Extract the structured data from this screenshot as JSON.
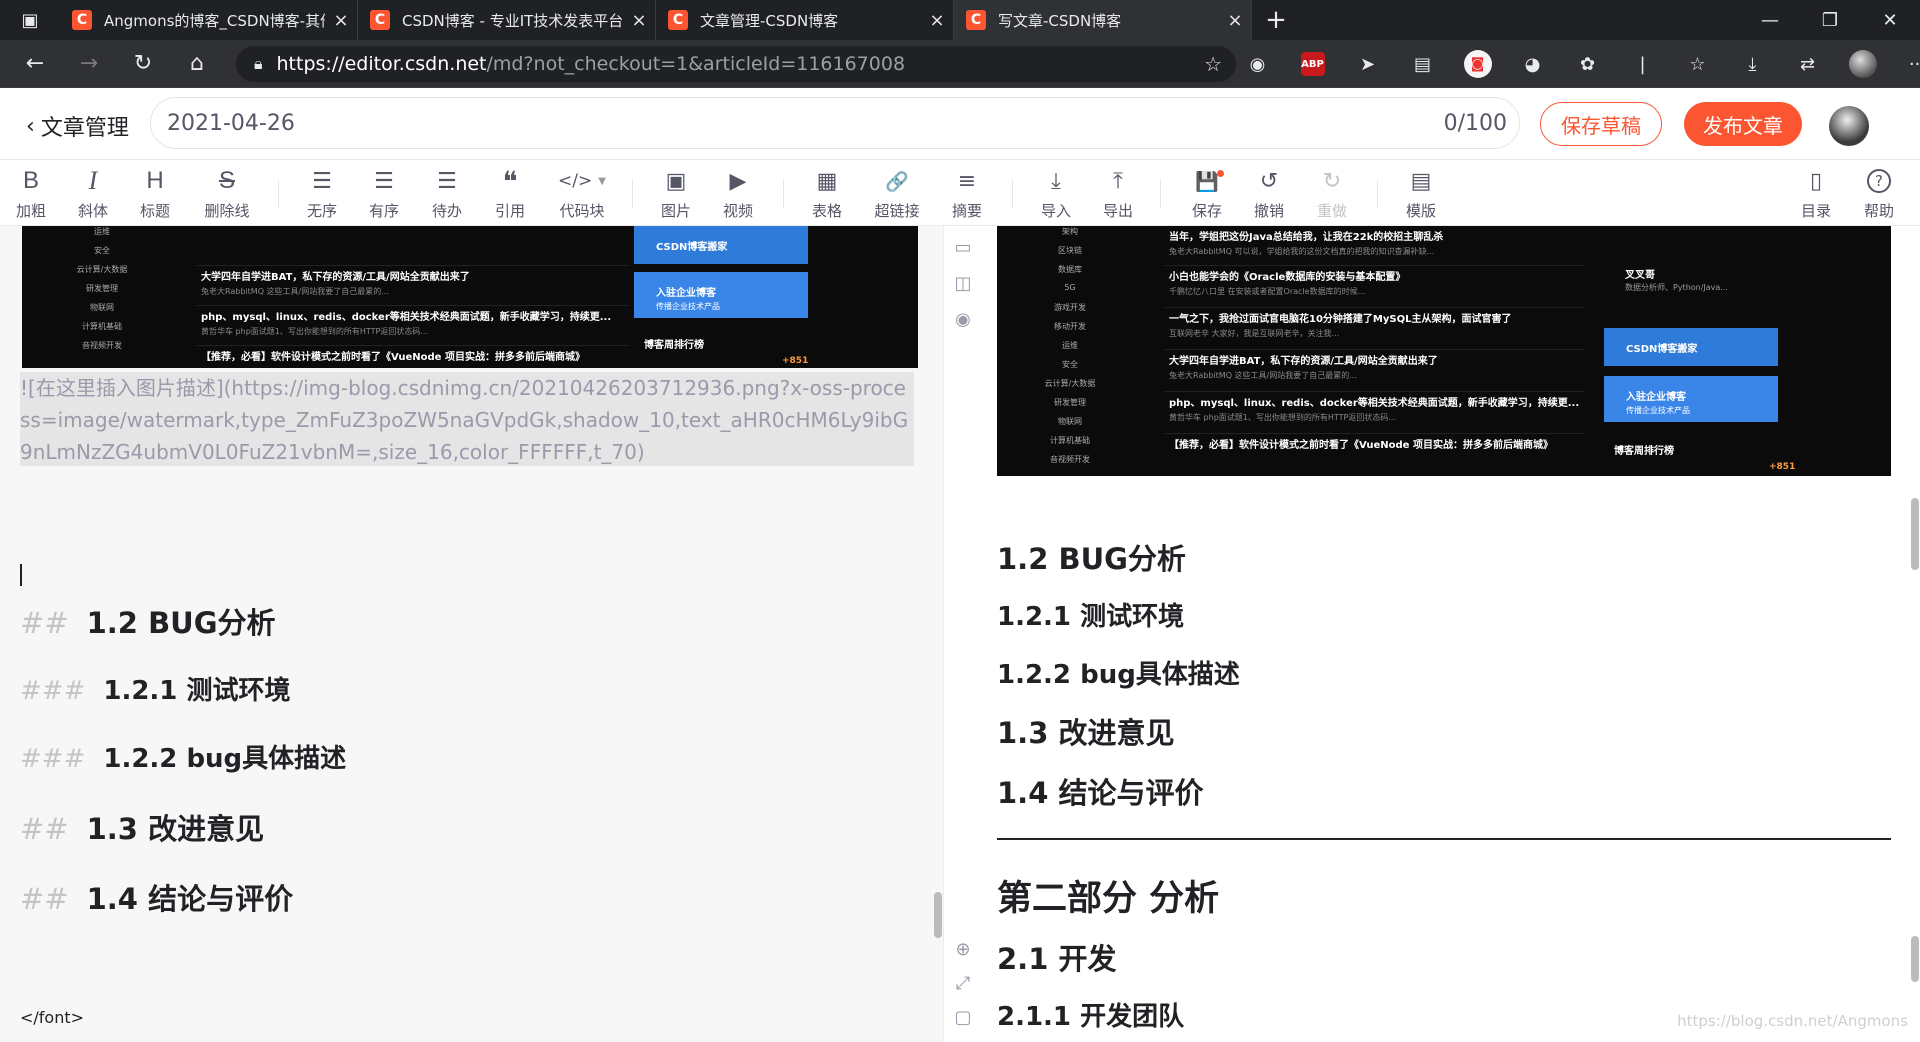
{
  "browser": {
    "tabs": [
      {
        "title": "Angmons的博客_CSDN博客-其他",
        "active": false
      },
      {
        "title": "CSDN博客 - 专业IT技术发表平台",
        "active": false
      },
      {
        "title": "文章管理-CSDN博客",
        "active": false
      },
      {
        "title": "写文章-CSDN博客",
        "active": true
      }
    ],
    "favicon_letter": "C",
    "url_host": "https://editor.csdn.net",
    "url_path": "/md?not_checkout=1&articleId=116167008",
    "extensions": [
      "owl-icon",
      "adblock-plus-icon",
      "cursor-icon",
      "collections-icon",
      "rss-icon",
      "chrome-icon",
      "cookie-icon",
      "favorites-icon",
      "download-icon",
      "share-icon",
      "profile-avatar",
      "more-icon"
    ],
    "abp_label": "ABP"
  },
  "header": {
    "back_label": "文章管理",
    "title_value": "2021-04-26",
    "title_count": "0/100",
    "save_draft": "保存草稿",
    "publish": "发布文章"
  },
  "toolbar": {
    "bold": {
      "icon": "B",
      "label": "加粗"
    },
    "italic": {
      "icon": "I",
      "label": "斜体"
    },
    "heading": {
      "icon": "H",
      "label": "标题"
    },
    "strike": {
      "icon": "S",
      "label": "删除线"
    },
    "ul": {
      "icon": "☰",
      "label": "无序"
    },
    "ol": {
      "icon": "☰",
      "label": "有序"
    },
    "todo": {
      "icon": "☰",
      "label": "待办"
    },
    "quote": {
      "icon": "❝",
      "label": "引用"
    },
    "code": {
      "icon": "</>",
      "label": "代码块"
    },
    "image": {
      "icon": "▣",
      "label": "图片"
    },
    "video": {
      "icon": "▶",
      "label": "视频"
    },
    "table": {
      "icon": "▦",
      "label": "表格"
    },
    "link": {
      "icon": "🔗",
      "label": "超链接"
    },
    "summary": {
      "icon": "≡",
      "label": "摘要"
    },
    "import": {
      "icon": "⤓",
      "label": "导入"
    },
    "export": {
      "icon": "⤒",
      "label": "导出"
    },
    "save": {
      "icon": "💾",
      "label": "保存"
    },
    "undo": {
      "icon": "↺",
      "label": "撤销"
    },
    "redo": {
      "icon": "↻",
      "label": "重做"
    },
    "template": {
      "icon": "▤",
      "label": "模版"
    },
    "toc": {
      "icon": "▯",
      "label": "目录"
    },
    "help": {
      "icon": "?",
      "label": "帮助"
    }
  },
  "editor": {
    "raw_image_link": "![在这里插入图片描述](https://img-blog.csdnimg.cn/20210426203712936.png?x-oss-process=image/watermark,type_ZmFuZ3poZW5naGVpdGk,shadow_10,text_aHR0cHM6Ly9ibG9nLmNzZG4ubmV0L0FuZ21vbnM=,size_16,color_FFFFFF,t_70)",
    "lines": [
      {
        "hash": "##",
        "text": "1.2 BUG分析"
      },
      {
        "hash": "###",
        "text": "1.2.1 测试环境"
      },
      {
        "hash": "###",
        "text": "1.2.2 bug具体描述"
      },
      {
        "hash": "##",
        "text": "1.3 改进意见"
      },
      {
        "hash": "##",
        "text": "1.4 结论与评价"
      }
    ],
    "font_close": "</font>"
  },
  "preview": {
    "headings": [
      {
        "level": "h2",
        "text": "1.2 BUG分析"
      },
      {
        "level": "h3",
        "text": "1.2.1 测试环境"
      },
      {
        "level": "h3",
        "text": "1.2.2 bug具体描述"
      },
      {
        "level": "h2",
        "text": "1.3 改进意见"
      },
      {
        "level": "h2",
        "text": "1.4 结论与评价"
      },
      {
        "level": "h1",
        "text": "第二部分 分析"
      },
      {
        "level": "h2",
        "text": "2.1 开发"
      },
      {
        "level": "h3",
        "text": "2.1.1 开发团队"
      }
    ],
    "watermark": "https://blog.csdn.net/Angmons"
  },
  "embedded_screenshot": {
    "side_menu": [
      "运维",
      "安全",
      "云计算/大数据",
      "研发管理",
      "物联网",
      "计算机基础",
      "音视频开发"
    ],
    "side_menu_preview": [
      "架构",
      "区块链",
      "数据库",
      "5G",
      "游戏开发",
      "移动开发",
      "运维",
      "安全",
      "云计算/大数据",
      "研发管理",
      "物联网",
      "计算机基础",
      "音视频开发"
    ],
    "posts": [
      {
        "title": "大学四年自学进BAT，私下存的资源/工具/网站全贡献出来了",
        "sub": "兔老大RabbitMQ  这些工具/网站我要了自己最累的..."
      },
      {
        "title": "php、mysql、linux、redis、docker等相关技术经典面试题，新手收藏学习，持续更...",
        "sub": "黄哲华车  php面试题1、写出你能想到的所有HTTP返回状态码..."
      },
      {
        "title": "【推荐，必看】软件设计模式之前时看了《VueNode 项目实战：拼多多前后端商城》",
        "sub": ""
      }
    ],
    "posts_preview": [
      {
        "title": "当年，学姐把这份Java总结给我，让我在22k的校招主聊乱杀",
        "sub": "兔老大RabbitMQ  可以说，学姐给我的这份文档真的把我的知识查漏补缺..."
      },
      {
        "title": "小白也能学会的《Oracle数据库的安装与基本配置》",
        "sub": "千鹏忆忆八口里  在安装或者配置Oracle数据库的时候..."
      },
      {
        "title": "一气之下，我抢过面试官电脑花10分钟搭建了MySQL主从架构，面试官害了",
        "sub": "互联网老辛  大家好，我是互联网老辛，关注我..."
      },
      {
        "title": "大学四年自学进BAT，私下存的资源/工具/网站全贡献出来了",
        "sub": "兔老大RabbitMQ  这些工具/网站我要了自己最累的..."
      },
      {
        "title": "php、mysql、linux、redis、docker等相关技术经典面试题，新手收藏学习，持续更...",
        "sub": "黄哲华车  php面试题1、写出你能想到的所有HTTP返回状态码..."
      },
      {
        "title": "【推荐，必看】软件设计模式之前时看了《VueNode 项目实战：拼多多前后端商城》",
        "sub": ""
      }
    ],
    "banner_move": "CSDN博客搬家",
    "banner_enter": "入驻企业博客",
    "banner_enter_sub": "传播企业技术产品",
    "rank_title": "博客周排行榜",
    "right_user": "叉叉哥",
    "right_user_sub": "数据分析师、Python/Java...",
    "footer_tag": "+851"
  },
  "colors": {
    "brand": "#fc5531",
    "tab_bar": "#202124",
    "text": "#222226",
    "muted": "#999aaa"
  }
}
